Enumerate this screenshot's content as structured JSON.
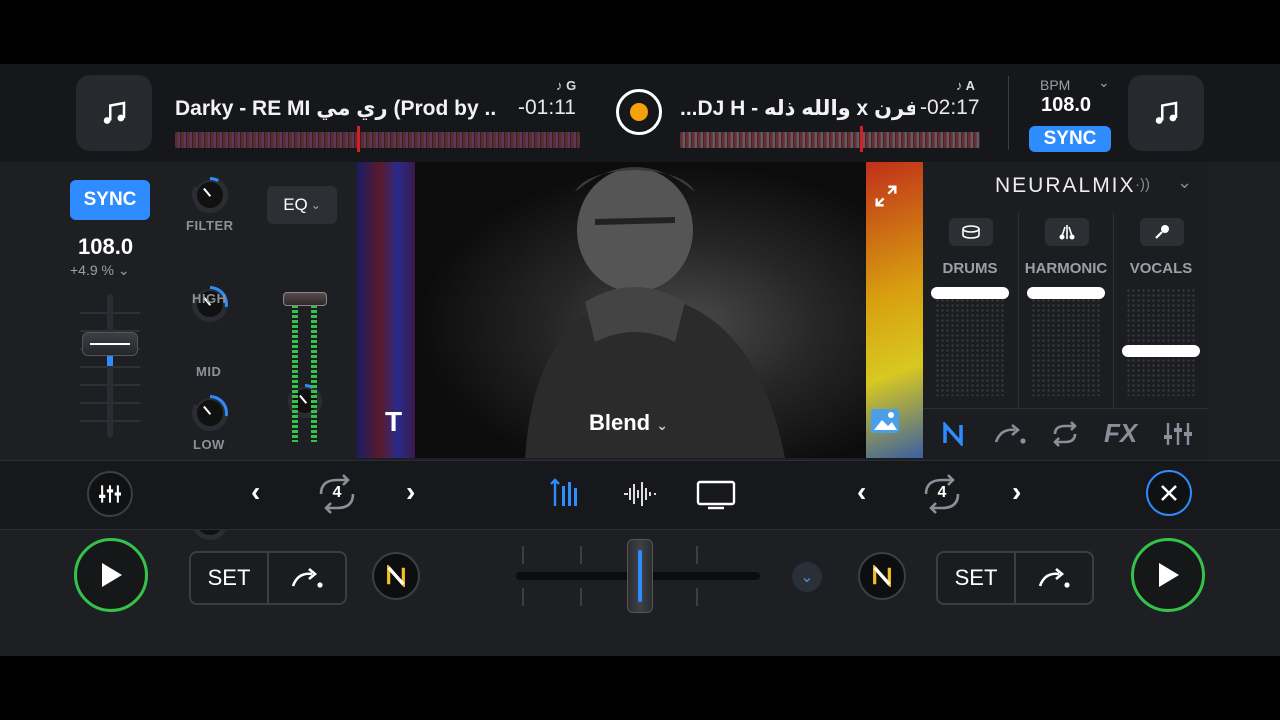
{
  "deck_left": {
    "title": "Darky - RE MI ري مي (Prod by ..",
    "time": "-01:11",
    "key": "G",
    "sync_label": "SYNC",
    "bpm": "108.0",
    "pitch": "+4.9 %",
    "knobs": {
      "filter": "FILTER",
      "high": "HIGH",
      "mid": "MID",
      "low": "LOW"
    },
    "eq_label": "EQ"
  },
  "deck_right": {
    "title": "...DJ H - والله ذله x فرن",
    "time": "-02:17",
    "key": "A"
  },
  "master": {
    "bpm_label": "BPM",
    "bpm": "108.0",
    "sync_label": "SYNC"
  },
  "video": {
    "text_tool": "T",
    "transition": "Blend"
  },
  "neuralmix": {
    "title": "NEURALMIX",
    "stems": [
      {
        "label": "DRUMS",
        "icon": "drum-icon",
        "level": 0.95
      },
      {
        "label": "HARMONIC",
        "icon": "guitar-icon",
        "level": 0.95
      },
      {
        "label": "VOCALS",
        "icon": "mic-icon",
        "level": 0.4
      }
    ],
    "tools": [
      "neural-icon",
      "cue-icon",
      "loop-icon",
      "fx-icon",
      "mixer-icon"
    ],
    "fx_label": "FX"
  },
  "midrow": {
    "loop_left": "4",
    "loop_right": "4"
  },
  "transport": {
    "set_left": "SET",
    "set_right": "SET"
  },
  "colors": {
    "accent": "#2f8cff",
    "play": "#35c24a",
    "record": "#f5a20a",
    "waveform_cue": "#d0202a"
  }
}
